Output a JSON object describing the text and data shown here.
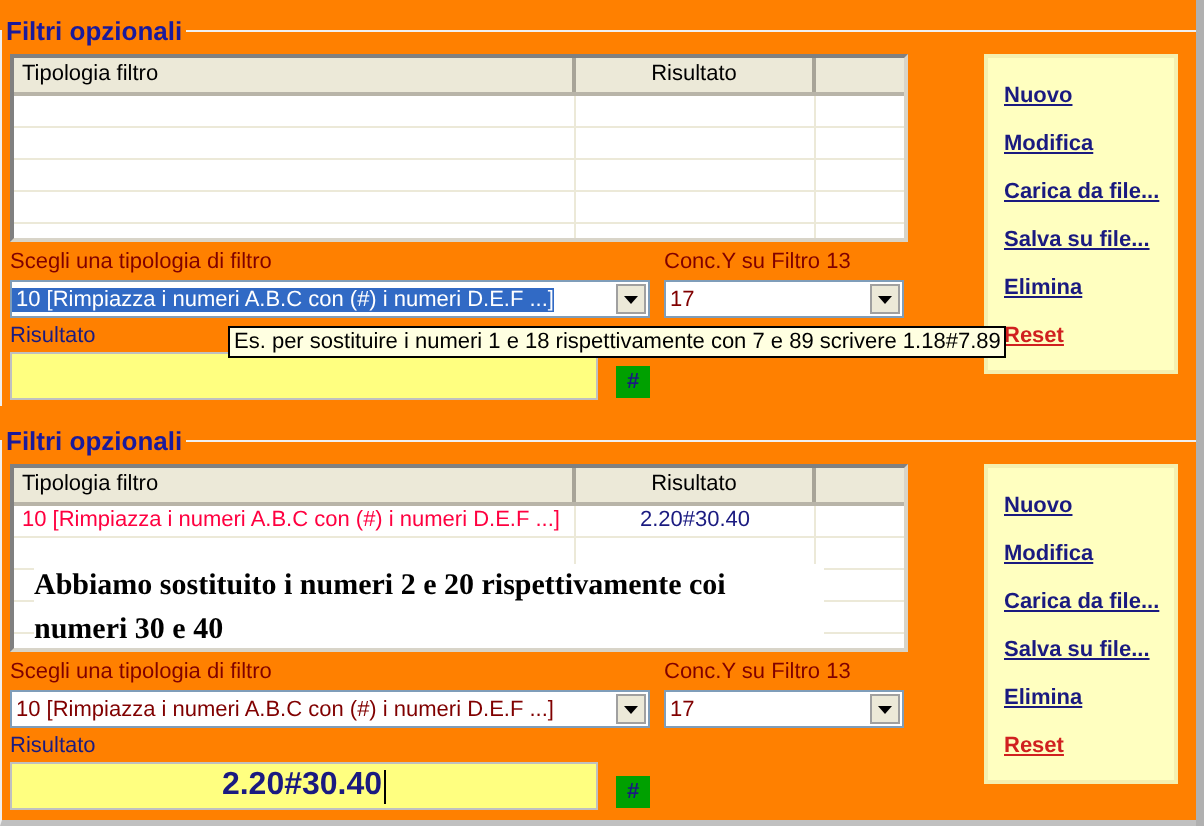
{
  "panels": [
    {
      "legend": "Filtri opzionali",
      "columns": [
        "Tipologia filtro",
        "Risultato"
      ],
      "filter_label": "Scegli una tipologia di filtro",
      "filter_value": "10 [Rimpiazza i numeri A.B.C con (#) i numeri D.E.F ...]",
      "filter_highlighted": true,
      "conc_label": "Conc.Y su Filtro 13",
      "conc_value": "17",
      "result_label": "Risultato",
      "hash_button": "#",
      "tooltip": "Es. per sostituire i numeri 1 e 18 rispettivamente con 7 e 89 scrivere 1.18#7.89",
      "actions": [
        {
          "label": "Nuovo",
          "kind": "link"
        },
        {
          "label": "Modifica",
          "kind": "link"
        },
        {
          "label": "Carica da file...",
          "kind": "link"
        },
        {
          "label": "Salva su file...",
          "kind": "link"
        },
        {
          "label": "Elimina",
          "kind": "link"
        },
        {
          "label": "Reset",
          "kind": "reset"
        }
      ]
    },
    {
      "legend": "Filtri opzionali",
      "columns": [
        "Tipologia filtro",
        "Risultato"
      ],
      "rows": [
        {
          "type": "10 [Rimpiazza i numeri A.B.C con (#) i numeri D.E.F ...]",
          "result": "2.20#30.40"
        }
      ],
      "annotation": "Abbiamo sostituito i numeri 2 e 20 rispettivamente coi numeri 30 e 40",
      "filter_label": "Scegli una tipologia di filtro",
      "filter_value": "10 [Rimpiazza i numeri A.B.C con (#) i numeri D.E.F ...]",
      "filter_highlighted": false,
      "conc_label": "Conc.Y su Filtro 13",
      "conc_value": "17",
      "result_label": "Risultato",
      "result_value": "2.20#30.40",
      "hash_button": "#",
      "actions": [
        {
          "label": "Nuovo",
          "kind": "link"
        },
        {
          "label": "Modifica",
          "kind": "link"
        },
        {
          "label": "Carica da file...",
          "kind": "link"
        },
        {
          "label": "Salva su file...",
          "kind": "link"
        },
        {
          "label": "Elimina",
          "kind": "link"
        },
        {
          "label": "Reset",
          "kind": "reset"
        }
      ]
    }
  ]
}
